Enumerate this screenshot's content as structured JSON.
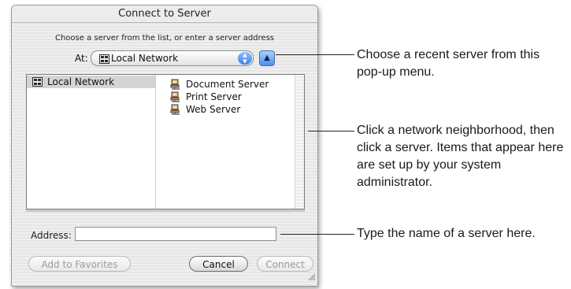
{
  "dialog": {
    "title": "Connect to Server",
    "instruction": "Choose a server from the list, or enter a server address",
    "at_label": "At:",
    "at_value": "Local Network",
    "browser": {
      "column1": [
        "Local Network"
      ],
      "column2": [
        "Document Server",
        "Print Server",
        "Web Server"
      ]
    },
    "address_label": "Address:",
    "address_value": "",
    "add_favorites_label": "Add to Favorites",
    "cancel_label": "Cancel",
    "connect_label": "Connect"
  },
  "callouts": {
    "recent": "Choose a recent server from this pop-up menu.",
    "browser": "Click a network neighborhood, then click a server. Items that appear here are set up by your system administrator.",
    "address": "Type the name of a server here."
  },
  "icons": {
    "network": "network-icon",
    "server": "server-icon",
    "popup_arrows": "popup-arrows-icon",
    "recent": "up-triangle-icon",
    "resize": "resize-grip-icon"
  },
  "colors": {
    "accent_blue": "#3a7fe6",
    "selection_gray": "#d4d4d4"
  }
}
